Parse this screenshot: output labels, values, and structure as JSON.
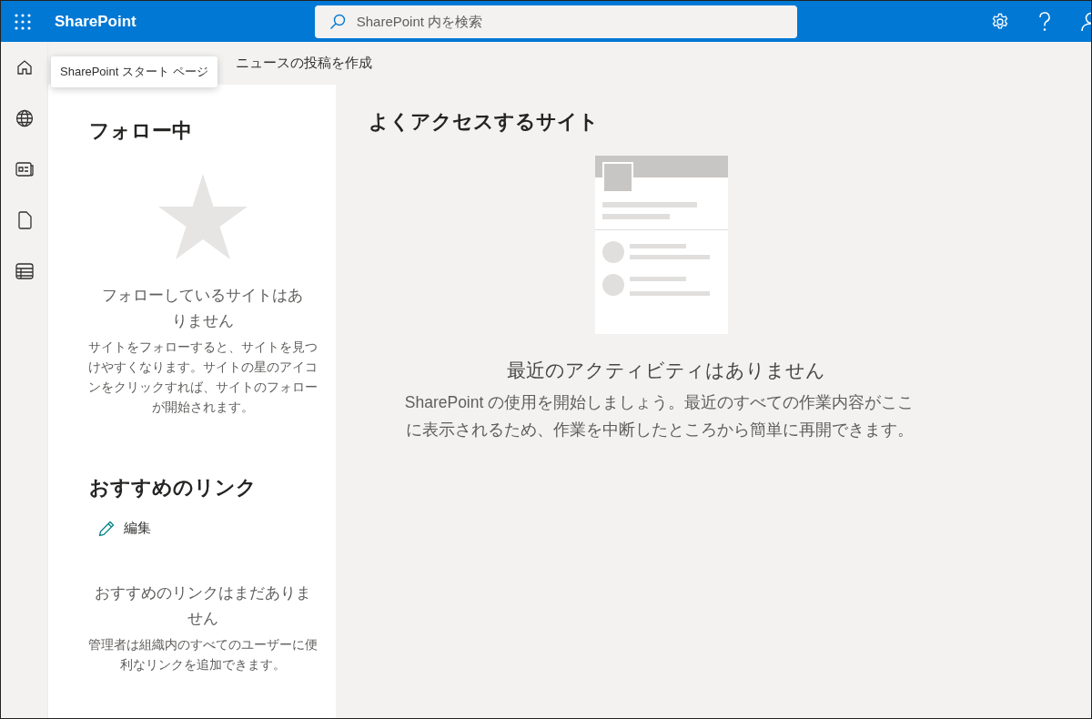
{
  "top_bar": {
    "app_name": "SharePoint",
    "search": {
      "placeholder": "SharePoint 内を検索"
    }
  },
  "nav_rail": {
    "items": [
      {
        "kind": "home"
      },
      {
        "kind": "globe"
      },
      {
        "kind": "news"
      },
      {
        "kind": "file"
      },
      {
        "kind": "list"
      }
    ]
  },
  "tooltip": "SharePoint スタート ページ",
  "command_bar": {
    "create_news": "ニュースの投稿を作成"
  },
  "following": {
    "title": "フォロー中",
    "empty_title": "フォローしているサイトはありません",
    "empty_text": "サイトをフォローすると、サイトを見つけやすくなります。サイトの星のアイコンをクリックすれば、サイトのフォローが開始されます。"
  },
  "recommended_links": {
    "title": "おすすめのリンク",
    "edit": "編集",
    "empty_title": "おすすめのリンクはまだありません",
    "empty_text": "管理者は組織内のすべてのユーザーに便利なリンクを追加できます。"
  },
  "frequent_sites": {
    "title": "よくアクセスするサイト",
    "empty_title": "最近のアクティビティはありません",
    "empty_text": "SharePoint の使用を開始しましょう。最近のすべての作業内容がここに表示されるため、作業を中断したところから簡単に再開できます。"
  }
}
